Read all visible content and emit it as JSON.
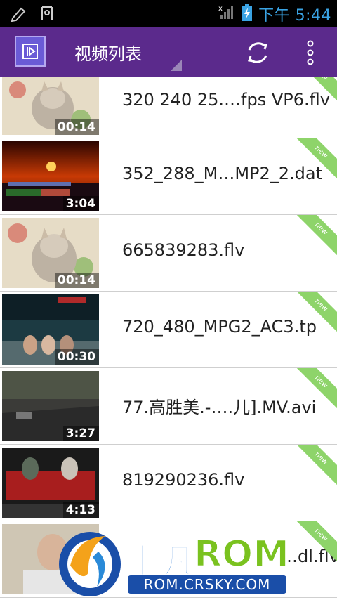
{
  "status_bar": {
    "time": "下午 5:44",
    "icons": [
      "pen-icon",
      "notification-icon",
      "signal-icon",
      "battery-charging-icon"
    ]
  },
  "action_bar": {
    "title": "视频列表",
    "icons": [
      "app-icon",
      "refresh-icon",
      "overflow-menu-icon"
    ],
    "background": "#5b2a8c"
  },
  "videos": [
    {
      "name": "320 240 25.…fps VP6.flv",
      "duration": "00:14",
      "badge": "new"
    },
    {
      "name": "352_288_M…MP2_2.dat",
      "duration": "3:04",
      "badge": "new"
    },
    {
      "name": "665839283.flv",
      "duration": "00:14",
      "badge": "new"
    },
    {
      "name": "720_480_MPG2_AC3.tp",
      "duration": "00:30",
      "badge": "new"
    },
    {
      "name": "77.高胜美.-….儿].MV.avi",
      "duration": "3:27",
      "badge": "new"
    },
    {
      "name": "819290236.flv",
      "duration": "4:13",
      "badge": "new"
    },
    {
      "name": "…dl.flv",
      "duration": "",
      "badge": "new"
    }
  ],
  "watermark": {
    "brand_cn": "非凡",
    "brand_en": "ROM",
    "url": "ROM.CRSKY.COM"
  },
  "colors": {
    "accent_time": "#3aa3e3",
    "new_badge": "#8ed46a"
  }
}
